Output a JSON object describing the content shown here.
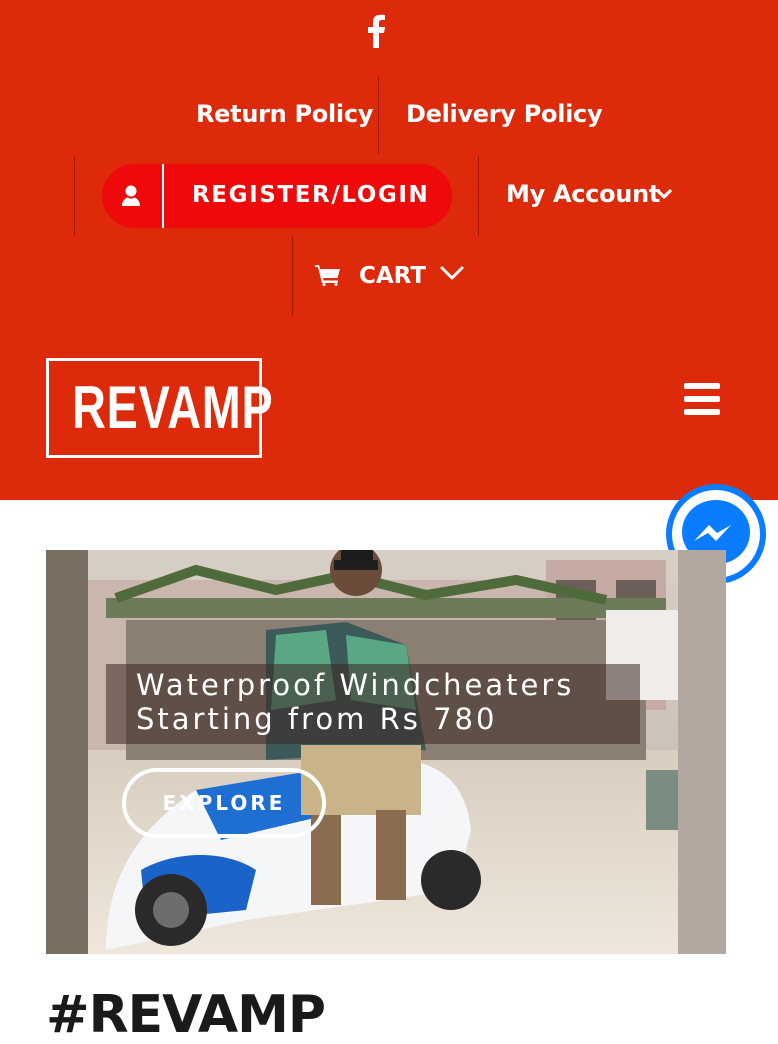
{
  "header": {
    "background_color": "#dd2a0a",
    "social": {
      "icon": "facebook-icon"
    },
    "policies": [
      {
        "label": "Return Policy"
      },
      {
        "label": "Delivery Policy"
      }
    ],
    "register": {
      "label": "REGISTER/LOGIN",
      "icon": "user-icon",
      "color": "#ee0a0a"
    },
    "account": {
      "label": "My Account",
      "icon": "chevron-down-icon"
    },
    "cart": {
      "label": "CART",
      "icon": "cart-icon"
    },
    "logo_text": "REVAMP",
    "menu_icon": "hamburger-icon"
  },
  "messenger": {
    "icon": "messenger-icon",
    "color": "#0a7cff"
  },
  "hero": {
    "caption_line1": "Waterproof Windcheaters",
    "caption_line2": "Starting from Rs 780",
    "button_label": "EXPLORE"
  },
  "main": {
    "heading": "#REVAMP"
  }
}
